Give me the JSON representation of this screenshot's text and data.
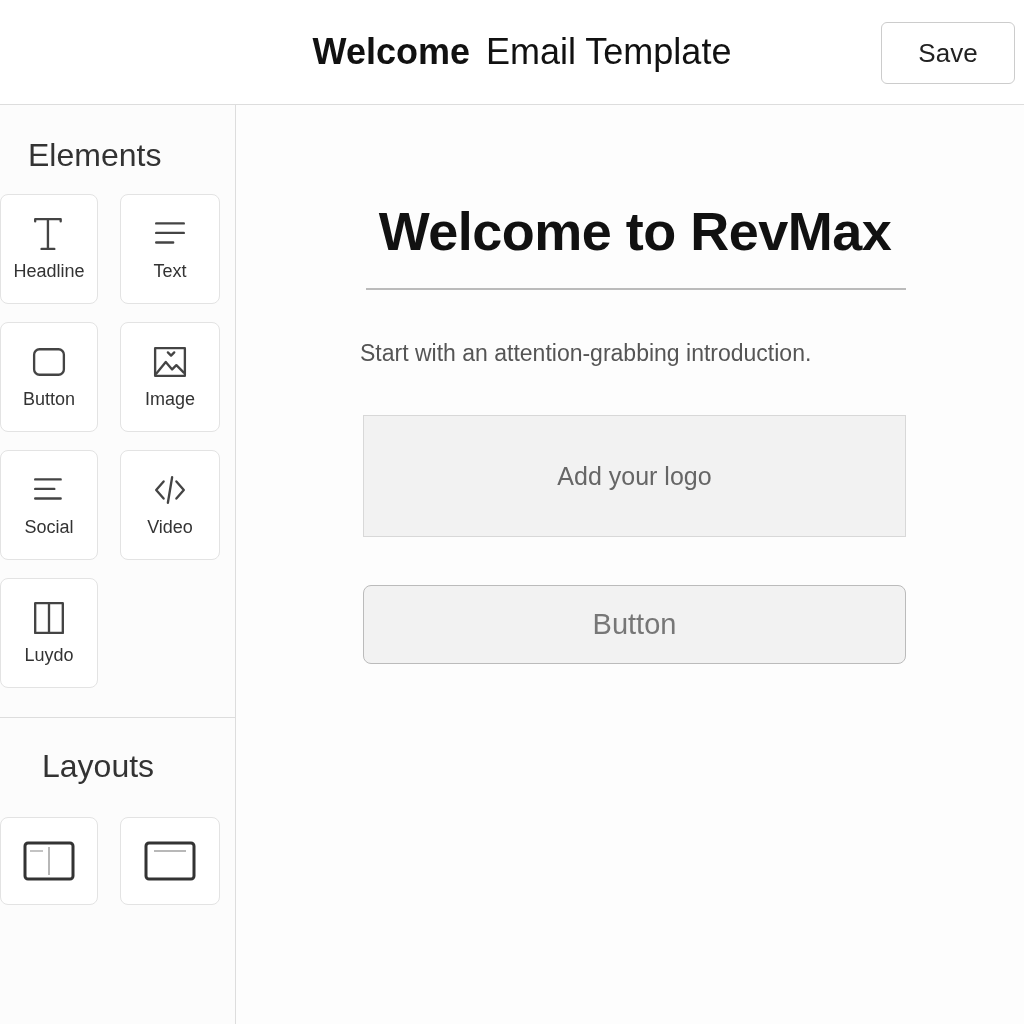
{
  "header": {
    "title": "**Welcome** Email Template",
    "save_button": "Save"
  },
  "sidebar": {
    "elements_heading": "Elements",
    "elements": [
      {
        "label": "Headline"
      },
      {
        "label": "Text"
      },
      {
        "label": "Button"
      },
      {
        "label": "Image"
      },
      {
        "label": "Social"
      },
      {
        "label": "Video"
      },
      {
        "label": "Luydo"
      }
    ],
    "layouts_heading": "Layouts"
  },
  "canvas": {
    "headline": "Welcome to RevMax",
    "intro": "Start with an attention-grabbing introduction.",
    "logo_placeholder": "Add your logo",
    "button": "Button"
  }
}
